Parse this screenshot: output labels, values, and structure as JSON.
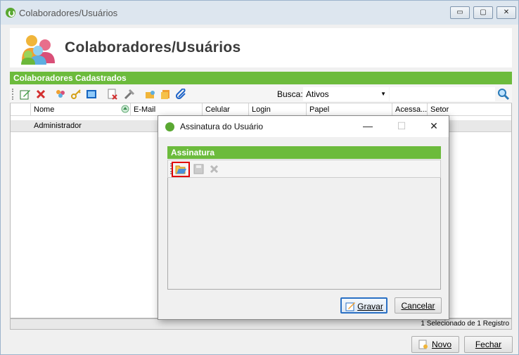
{
  "window": {
    "title": "Colaboradores/Usuários",
    "controls": {
      "minimize": "▭",
      "maximize": "▢",
      "close": "✕"
    }
  },
  "header": {
    "title": "Colaboradores/Usuários"
  },
  "panel": {
    "title": "Colaboradores Cadastrados"
  },
  "toolbar": {
    "busca_label": "Busca:",
    "busca_value": "Ativos",
    "search_placeholder": ""
  },
  "grid": {
    "columns": [
      "Nome",
      "E-Mail",
      "Celular",
      "Login",
      "Papel",
      "Acessa...",
      "Setor"
    ],
    "rows": [
      {
        "nome": "Administrador"
      }
    ]
  },
  "status": {
    "text": "1 Selecionado de 1 Registro"
  },
  "buttons": {
    "novo": "Novo",
    "fechar": "Fechar"
  },
  "dialog": {
    "title": "Assinatura do Usuário",
    "panel_title": "Assinatura",
    "gravar": "Gravar",
    "cancelar": "Cancelar"
  },
  "colors": {
    "accent_green": "#6cbb3c",
    "highlight_red": "#e00000"
  }
}
